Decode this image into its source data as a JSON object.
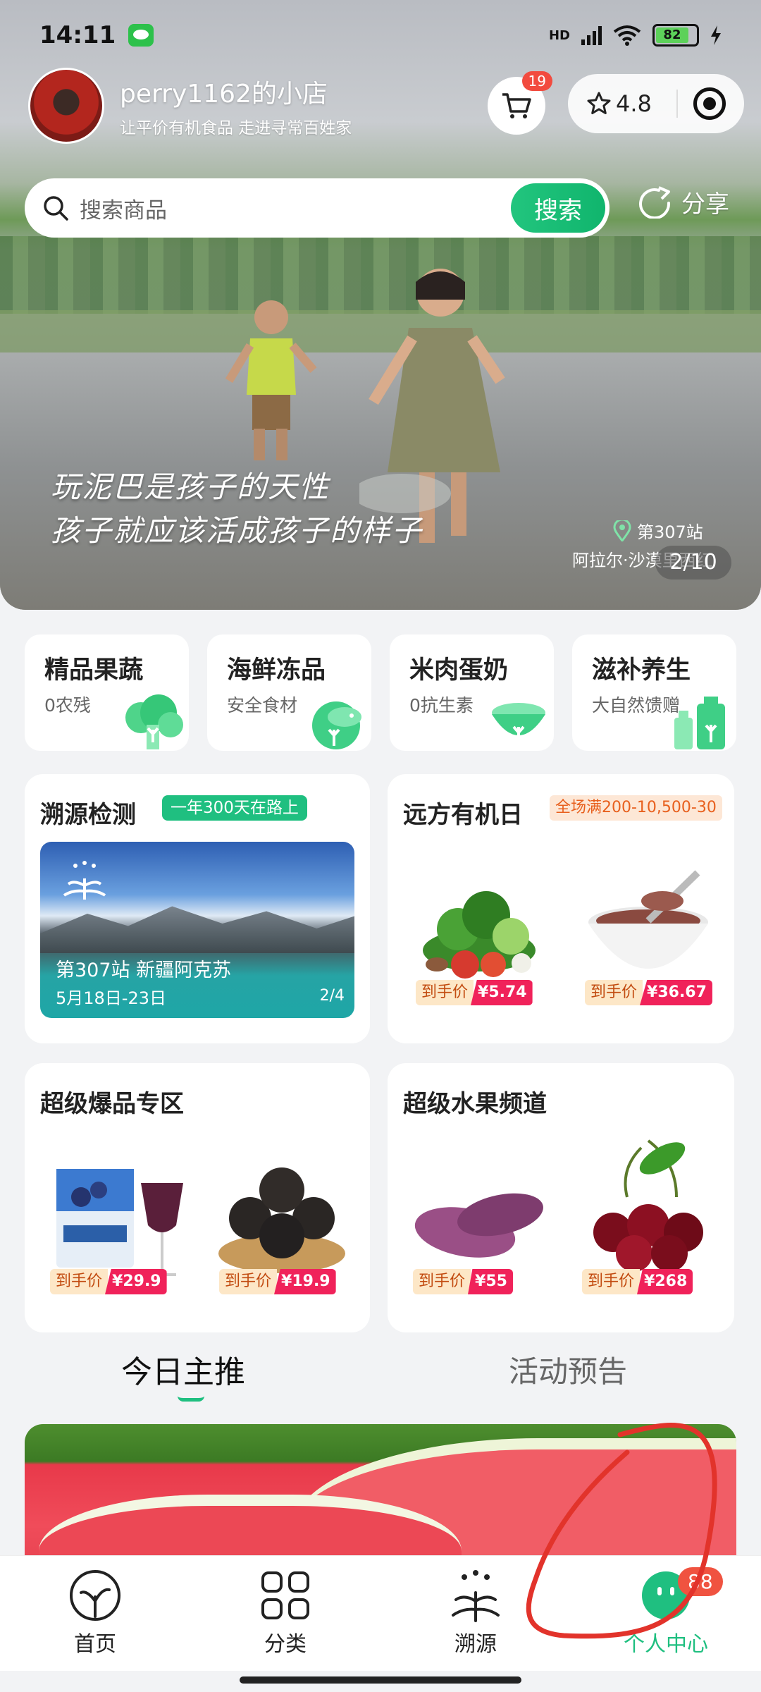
{
  "status_bar": {
    "time": "14:11",
    "network": "HD",
    "battery": "82"
  },
  "shop": {
    "name": "perry1162的小店",
    "slogan": "让平价有机食品 走进寻常百姓家",
    "cart_count": "19",
    "rating": "4.8"
  },
  "search": {
    "placeholder": "搜索商品",
    "button": "搜索",
    "share": "分享"
  },
  "banner": {
    "line1": "玩泥巴是孩子的天性",
    "line2": "孩子就应该活成孩子的样子",
    "station": "第307站",
    "location": "阿拉尔·沙漠里西红",
    "pager": "2/10"
  },
  "categories": [
    {
      "title": "精品果蔬",
      "subtitle": "0农残"
    },
    {
      "title": "海鲜冻品",
      "subtitle": "安全食材"
    },
    {
      "title": "米肉蛋奶",
      "subtitle": "0抗生素"
    },
    {
      "title": "滋补养生",
      "subtitle": "大自然馈赠"
    }
  ],
  "trace_card": {
    "title": "溯源检测",
    "tag": "一年300天在路上",
    "station": "第307站 新疆阿克苏",
    "dates": "5月18日-23日",
    "pager": "2/4"
  },
  "organic_card": {
    "title": "远方有机日",
    "tag": "全场满200-10,500-30",
    "products": [
      {
        "label": "到手价",
        "price": "¥5.74"
      },
      {
        "label": "到手价",
        "price": "¥36.67"
      }
    ]
  },
  "hot_card": {
    "title": "超级爆品专区",
    "products": [
      {
        "label": "到手价",
        "price": "¥29.9"
      },
      {
        "label": "到手价",
        "price": "¥19.9"
      }
    ]
  },
  "fruit_card": {
    "title": "超级水果频道",
    "products": [
      {
        "label": "到手价",
        "price": "¥55"
      },
      {
        "label": "到手价",
        "price": "¥268"
      }
    ]
  },
  "feed_tabs": [
    {
      "label": "今日主推"
    },
    {
      "label": "活动预告"
    }
  ],
  "bottom_nav": [
    {
      "label": "首页",
      "icon": "home-sprout-icon"
    },
    {
      "label": "分类",
      "icon": "category-grid-icon"
    },
    {
      "label": "溯源",
      "icon": "trace-icon"
    },
    {
      "label": "个人中心",
      "icon": "profile-icon",
      "badge": "88"
    }
  ],
  "colors": {
    "brand_green": "#1fbf80",
    "price_pink": "#f0225a",
    "badge_red": "#f05340"
  }
}
